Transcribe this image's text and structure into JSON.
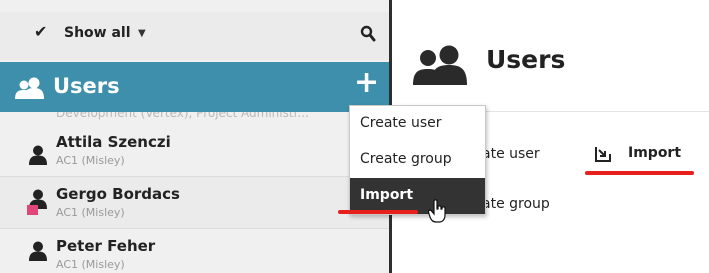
{
  "filterbar": {
    "label": "Show all"
  },
  "group": {
    "title": "Users",
    "add_symbol": "+"
  },
  "cut_text": "Development (Vertex), Project Administr...",
  "users": [
    {
      "name": "Attila Szenczi",
      "org": "AC1 (Misley)"
    },
    {
      "name": "Gergo Bordacs",
      "org": "AC1 (Misley)"
    },
    {
      "name": "Peter Feher",
      "org": "AC1 (Misley)"
    }
  ],
  "menu": [
    "Create user",
    "Create group",
    "Import"
  ],
  "main": {
    "title": "Users",
    "create_user": "ate user",
    "create_group": "ate group",
    "import": "Import"
  },
  "colors": {
    "header": "#3e8fac",
    "highlight": "#e8201c",
    "badge": "#e0457b"
  }
}
